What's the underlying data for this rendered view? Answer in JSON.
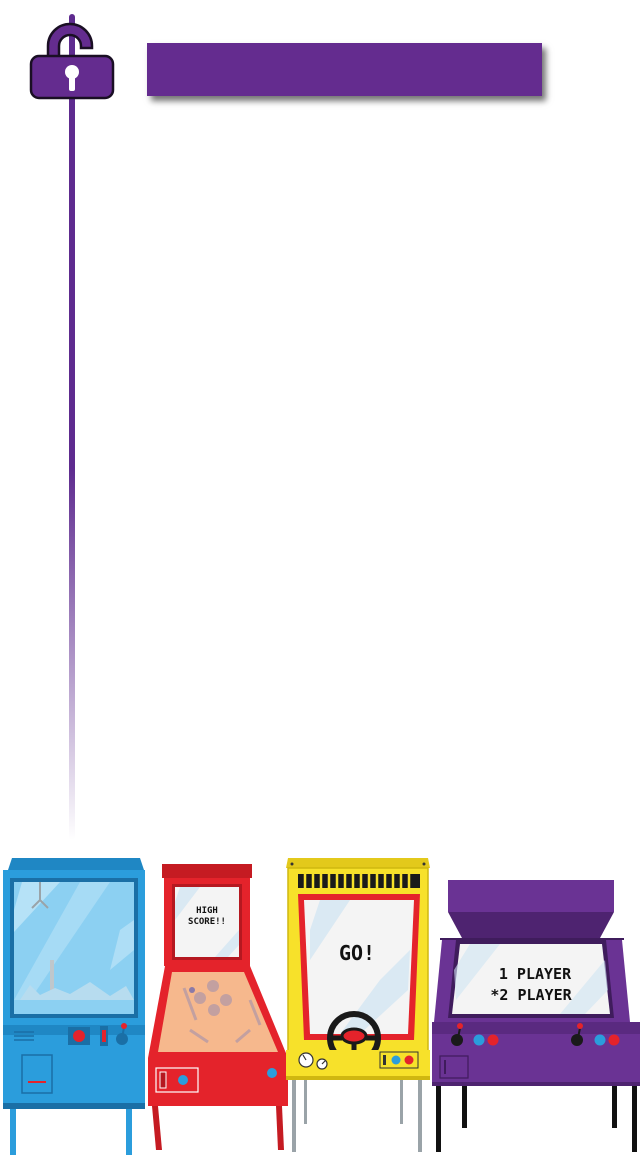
{
  "header": {
    "title": "",
    "lock_icon": "unlocked-padlock-icon",
    "accent_color": "#642c8f"
  },
  "cabinets": {
    "claw": {
      "color": "#2b9ddc",
      "icon": "claw-machine-icon"
    },
    "pinball": {
      "color": "#e4232b",
      "screen_line1": "HIGH",
      "screen_line2": "SCORE!!"
    },
    "racing": {
      "color": "#f7e12a",
      "screen_text": "GO!"
    },
    "fighter": {
      "color": "#6a3394",
      "option1": "1 PLAYER",
      "option2": "*2 PLAYER"
    }
  }
}
